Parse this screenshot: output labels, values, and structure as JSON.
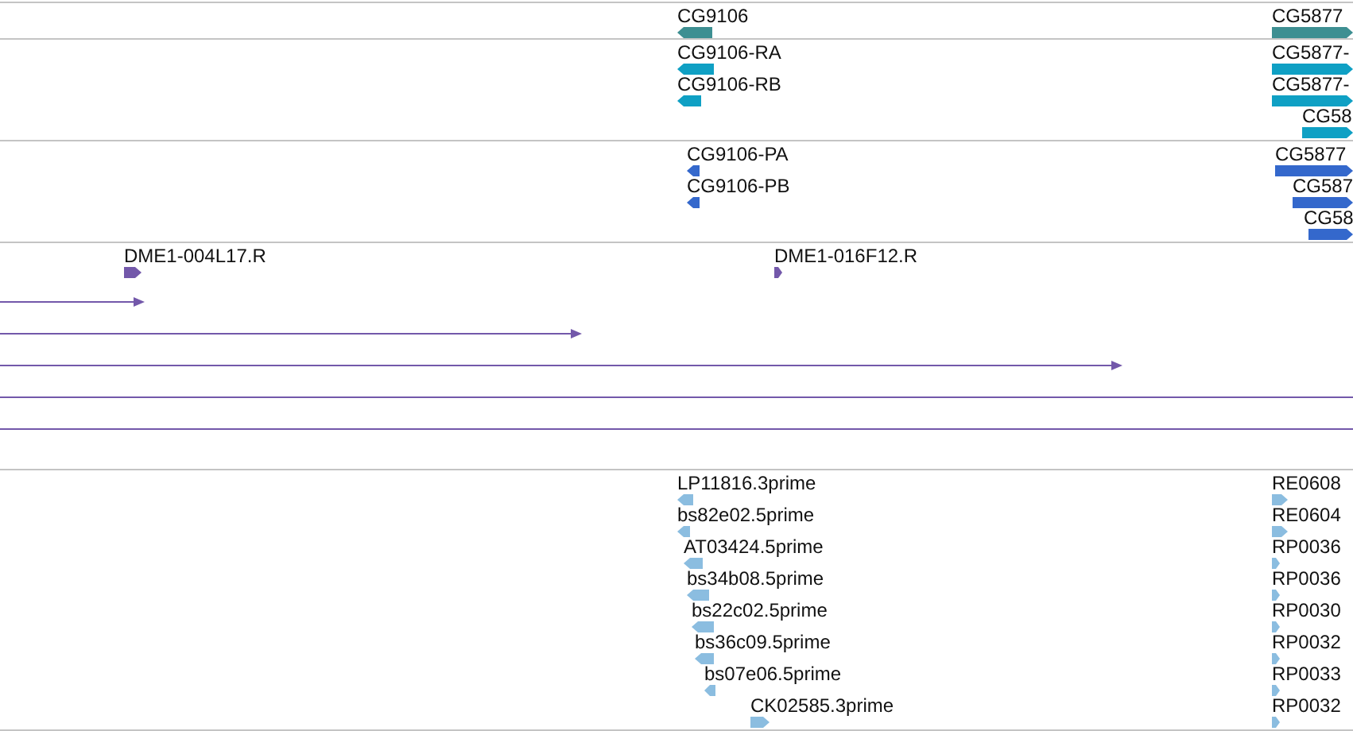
{
  "tracks": [
    {
      "color": "#3d8f92",
      "features": [
        {
          "label": "CG9106",
          "reverse": true
        },
        {
          "label": "CG5877",
          "reverse": false
        }
      ]
    },
    {
      "color": "#0fa0c4",
      "features": [
        {
          "label": "CG9106-RA",
          "reverse": true
        },
        {
          "label": "CG9106-RB",
          "reverse": true
        },
        {
          "label": "CG5877-",
          "reverse": false
        },
        {
          "label": "CG5877-",
          "reverse": false
        },
        {
          "label": "CG58",
          "reverse": false
        }
      ]
    },
    {
      "color": "#3468cc",
      "features": [
        {
          "label": "CG9106-PA",
          "reverse": true
        },
        {
          "label": "CG9106-PB",
          "reverse": true
        },
        {
          "label": "CG5877",
          "reverse": false
        },
        {
          "label": "CG587",
          "reverse": false
        },
        {
          "label": "CG58",
          "reverse": false
        }
      ]
    },
    {
      "color": "#7358aa",
      "features": [
        {
          "label": "DME1-004L17.R",
          "reverse": false,
          "kind": "block"
        },
        {
          "label": "DME1-016F12.R",
          "reverse": false,
          "kind": "block"
        },
        {
          "reverse": false,
          "kind": "line"
        },
        {
          "reverse": false,
          "kind": "line"
        },
        {
          "reverse": false,
          "kind": "line"
        },
        {
          "kind": "plain"
        },
        {
          "kind": "plain"
        }
      ]
    },
    {
      "color": "#8bbde0",
      "features": [
        {
          "label": "LP11816.3prime",
          "reverse": true
        },
        {
          "label": "bs82e02.5prime",
          "reverse": true
        },
        {
          "label": "AT03424.5prime",
          "reverse": true
        },
        {
          "label": "bs34b08.5prime",
          "reverse": true
        },
        {
          "label": "bs22c02.5prime",
          "reverse": true
        },
        {
          "label": "bs36c09.5prime",
          "reverse": true
        },
        {
          "label": "bs07e06.5prime",
          "reverse": true
        },
        {
          "label": "CK02585.3prime",
          "reverse": false
        },
        {
          "label": "RE0608",
          "reverse": false
        },
        {
          "label": "RE0604",
          "reverse": false
        },
        {
          "label": "RP0036",
          "reverse": false
        },
        {
          "label": "RP0036",
          "reverse": false
        },
        {
          "label": "RP0030",
          "reverse": false
        },
        {
          "label": "RP0032",
          "reverse": false
        },
        {
          "label": "RP0033",
          "reverse": false
        },
        {
          "label": "RP0032",
          "reverse": false
        }
      ]
    }
  ]
}
